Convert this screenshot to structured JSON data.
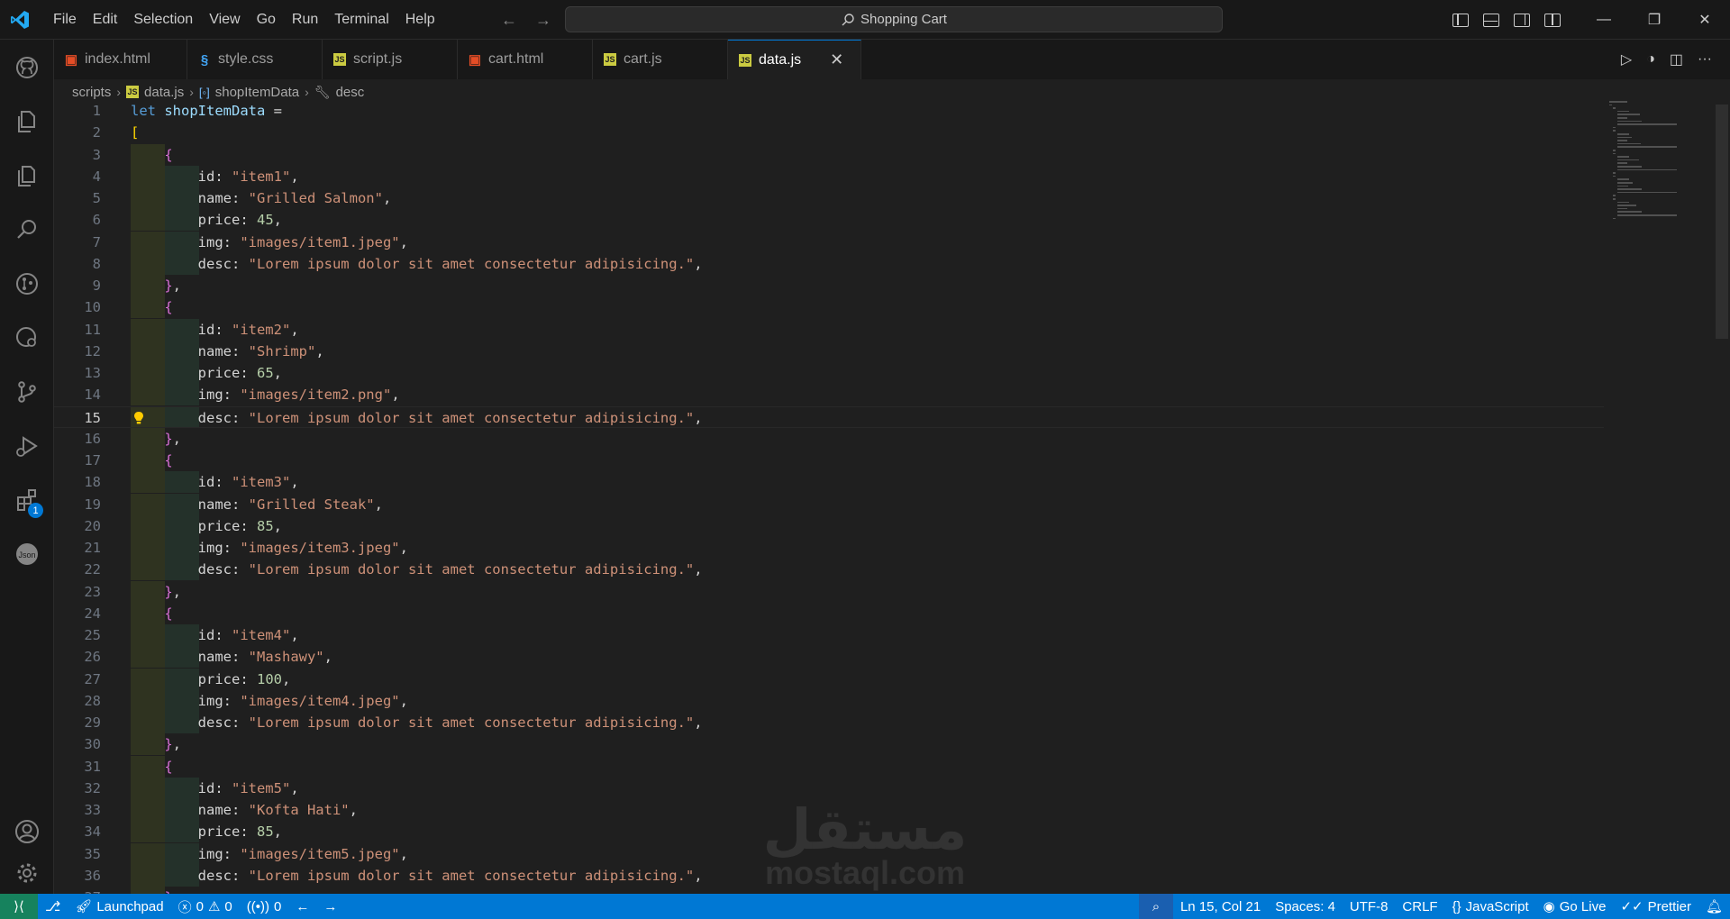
{
  "titlebar": {
    "menu": [
      "File",
      "Edit",
      "Selection",
      "View",
      "Go",
      "Run",
      "Terminal",
      "Help"
    ],
    "search_text": "Shopping Cart"
  },
  "tabs": [
    {
      "label": "index.html",
      "type": "html",
      "active": false
    },
    {
      "label": "style.css",
      "type": "css",
      "active": false
    },
    {
      "label": "script.js",
      "type": "js",
      "active": false
    },
    {
      "label": "cart.html",
      "type": "html",
      "active": false
    },
    {
      "label": "cart.js",
      "type": "js",
      "active": false
    },
    {
      "label": "data.js",
      "type": "js",
      "active": true
    }
  ],
  "breadcrumb": [
    "scripts",
    "data.js",
    "shopItemData",
    "desc"
  ],
  "activity": {
    "extensions_badge": "1"
  },
  "editor": {
    "active_line": 15
  },
  "items": [
    {
      "id": "\"item1\"",
      "name": "\"Grilled Salmon\"",
      "price": "45",
      "img": "\"images/item1.jpeg\"",
      "desc": "\"Lorem ipsum dolor sit amet consectetur adipisicing.\""
    },
    {
      "id": "\"item2\"",
      "name": "\"Shrimp\"",
      "price": "65",
      "img": "\"images/item2.png\"",
      "desc": "\"Lorem ipsum dolor sit amet consectetur adipisicing.\""
    },
    {
      "id": "\"item3\"",
      "name": "\"Grilled Steak\"",
      "price": "85",
      "img": "\"images/item3.jpeg\"",
      "desc": "\"Lorem ipsum dolor sit amet consectetur adipisicing.\""
    },
    {
      "id": "\"item4\"",
      "name": "\"Mashawy\"",
      "price": "100",
      "img": "\"images/item4.jpeg\"",
      "desc": "\"Lorem ipsum dolor sit amet consectetur adipisicing.\""
    },
    {
      "id": "\"item5\"",
      "name": "\"Kofta Hati\"",
      "price": "85",
      "img": "\"images/item5.jpeg\"",
      "desc": "\"Lorem ipsum dolor sit amet consectetur adipisicing.\""
    }
  ],
  "code_header": {
    "keyword": "let",
    "variable": "shopItemData",
    "op": "="
  },
  "watermark": {
    "arabic": "مستقل",
    "latin": "mostaql.com"
  },
  "status": {
    "launchpad": "Launchpad",
    "errors": "0",
    "warnings": "0",
    "ports": "0",
    "position": "Ln 15, Col 21",
    "spaces": "Spaces: 4",
    "encoding": "UTF-8",
    "eol": "CRLF",
    "language": "JavaScript",
    "golive": "Go Live",
    "prettier": "Prettier"
  },
  "colors": {
    "accent": "#0078d4",
    "remote": "#16825d",
    "string": "#ce9178",
    "keyword": "#569cd6",
    "number": "#b5cea8"
  }
}
